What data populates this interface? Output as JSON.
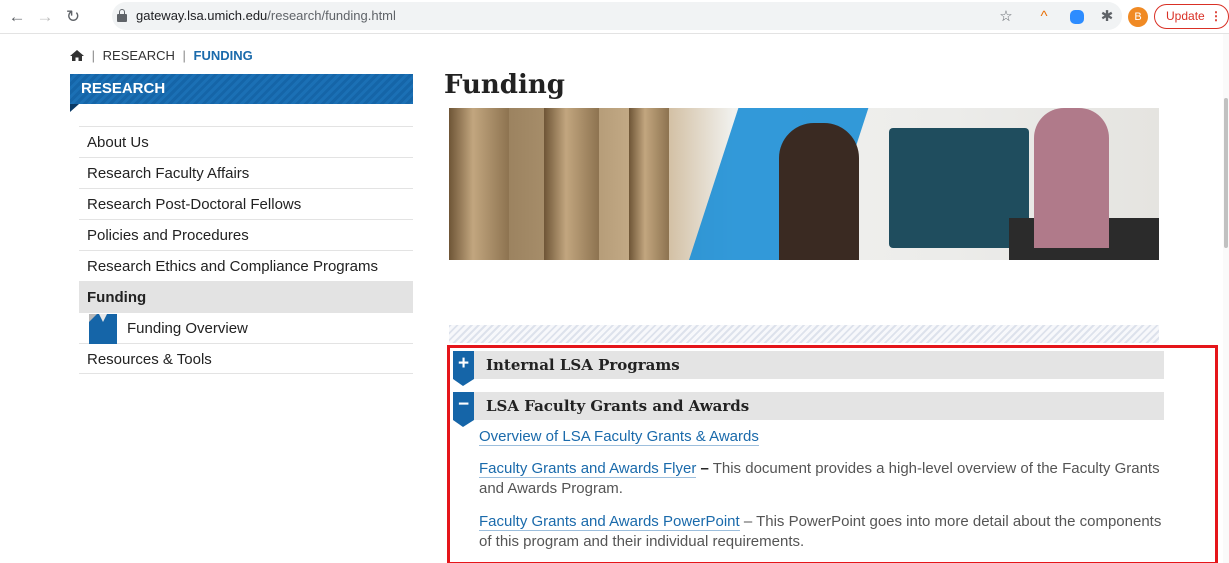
{
  "browser": {
    "url_host": "gateway.lsa.umich.edu",
    "url_path": "/research/funding.html",
    "profile_initial": "B",
    "update_label": "Update",
    "icons": [
      "back-arrow-icon",
      "forward-arrow-icon",
      "reload-icon",
      "lock-icon",
      "star-icon",
      "extension-icon",
      "zoom-icon",
      "puzzle-icon",
      "kebab-menu-icon"
    ]
  },
  "breadcrumb": {
    "section": "RESEARCH",
    "current": "FUNDING",
    "separator": "|"
  },
  "sidebar": {
    "banner": "RESEARCH",
    "items": [
      {
        "label": "About Us"
      },
      {
        "label": "Research Faculty Affairs"
      },
      {
        "label": "Research Post-Doctoral Fellows"
      },
      {
        "label": "Policies and Procedures"
      },
      {
        "label": "Research Ethics and Compliance Programs"
      },
      {
        "label": "Funding"
      },
      {
        "label": "Funding Overview"
      },
      {
        "label": "Resources & Tools"
      }
    ]
  },
  "main": {
    "title": "Funding",
    "accordion": [
      {
        "title": "Internal LSA Programs",
        "toggle": "+"
      },
      {
        "title": "LSA Faculty Grants and Awards",
        "toggle": "−"
      }
    ],
    "content": {
      "link1": "Overview of LSA Faculty Grants & Awards",
      "link2": "Faculty Grants and Awards Flyer",
      "dash2": "–",
      "text2": " This document provides a high-level overview of the Faculty Grants and Awards Program.",
      "link3": "Faculty Grants and Awards PowerPoint",
      "text3": " – This PowerPoint goes into more detail about the components of this program and their individual requirements."
    }
  },
  "colors": {
    "brand_blue": "#1565a8",
    "highlight_red": "#e5151a",
    "link": "#1a6aab"
  }
}
